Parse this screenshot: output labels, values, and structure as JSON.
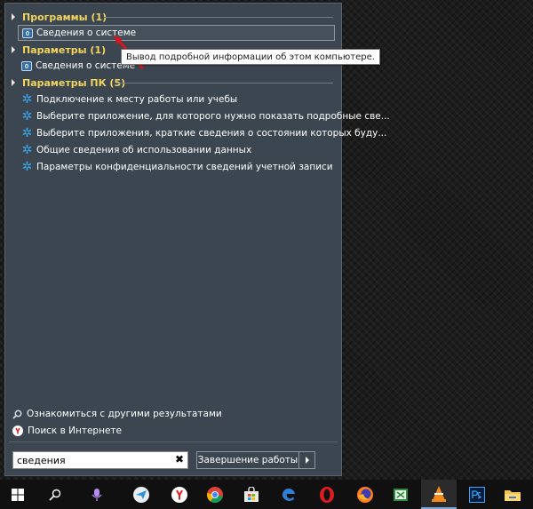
{
  "groups": {
    "programs": {
      "title": "Программы (1)",
      "items": [
        "Сведения о системе"
      ]
    },
    "settings": {
      "title": "Параметры (1)",
      "items": [
        "Сведения о системе"
      ]
    },
    "pc_settings": {
      "title": "Параметры ПК (5)",
      "items": [
        "Подключение к месту работы или учебы",
        "Выберите приложение, для которого нужно показать подробные све...",
        "Выберите приложения, краткие сведения о состоянии которых буду...",
        "Общие сведения об использовании данных",
        "Параметры конфиденциальности сведений учетной записи"
      ]
    }
  },
  "tooltip": "Вывод подробной информации об этом компьютере.",
  "more_results": "Ознакомиться с другими результатами",
  "web_search": "Поиск в Интернете",
  "search": {
    "value": "сведения"
  },
  "shutdown_label": "Завершение работы",
  "colors": {
    "group_title": "#f2d45c",
    "menu_bg": "#3c4650",
    "gear": "#3aa7f0",
    "annotation_arrow": "#d9141b"
  },
  "taskbar_icons": [
    "windows-start-icon",
    "search-icon",
    "cortana-icon",
    "paper-plane-icon",
    "yandex-browser-icon",
    "chrome-icon",
    "store-icon",
    "edge-icon",
    "opera-icon",
    "firefox-icon",
    "spreadsheet-icon",
    "vlc-icon",
    "photoshop-icon",
    "file-explorer-icon"
  ]
}
